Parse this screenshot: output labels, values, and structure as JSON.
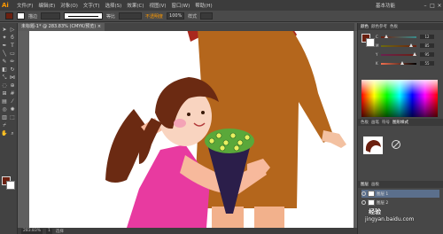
{
  "app": {
    "logo": "Ai",
    "title": "基本功能"
  },
  "menu": {
    "items": [
      "文件(F)",
      "编辑(E)",
      "对象(O)",
      "文字(T)",
      "选择(S)",
      "效果(C)",
      "视图(V)",
      "窗口(W)",
      "帮助(H)"
    ]
  },
  "window_buttons": {
    "minimize": "–",
    "maximize": "□",
    "close": "×"
  },
  "control_bar": {
    "fill_color": "#6b2010",
    "stroke_label": "描边",
    "stroke_value": "",
    "profile_label": "等比",
    "opacity_label": "不透明度",
    "opacity_value": "100%",
    "style_label": "样式"
  },
  "document": {
    "tab_label": "未标题-1* @ 283.83% (CMYK/预览)",
    "close": "×"
  },
  "status": {
    "zoom": "283.83%",
    "page": "1",
    "tool": "选择"
  },
  "panels": {
    "color_tabs": [
      "颜色",
      "颜色参考",
      "色板"
    ],
    "color_values": [
      "C",
      "M",
      "Y",
      "K"
    ],
    "color_numbers": [
      "12",
      "85",
      "95",
      "55"
    ],
    "brush_tabs": [
      "色板",
      "画笔",
      "符号",
      "图形样式"
    ],
    "layers_tabs": [
      "图层",
      "画板"
    ],
    "layers": [
      {
        "name": "图层 1"
      },
      {
        "name": "图层 2"
      }
    ]
  },
  "watermark": {
    "line1": "经验",
    "line2": "jingyan.baidu.com"
  },
  "icons": [
    "selection-icon",
    "direct-selection-icon",
    "magic-wand-icon",
    "lasso-icon",
    "pen-icon",
    "type-icon",
    "line-icon",
    "rectangle-icon",
    "paintbrush-icon",
    "pencil-icon",
    "eraser-icon",
    "rotate-icon",
    "scale-icon",
    "width-icon",
    "warp-icon",
    "shape-builder-icon",
    "perspective-icon",
    "mesh-icon",
    "gradient-icon",
    "eyedropper-icon",
    "blend-icon",
    "symbol-sprayer-icon",
    "graph-icon",
    "artboard-icon",
    "slice-icon",
    "hand-icon",
    "zoom-icon"
  ]
}
